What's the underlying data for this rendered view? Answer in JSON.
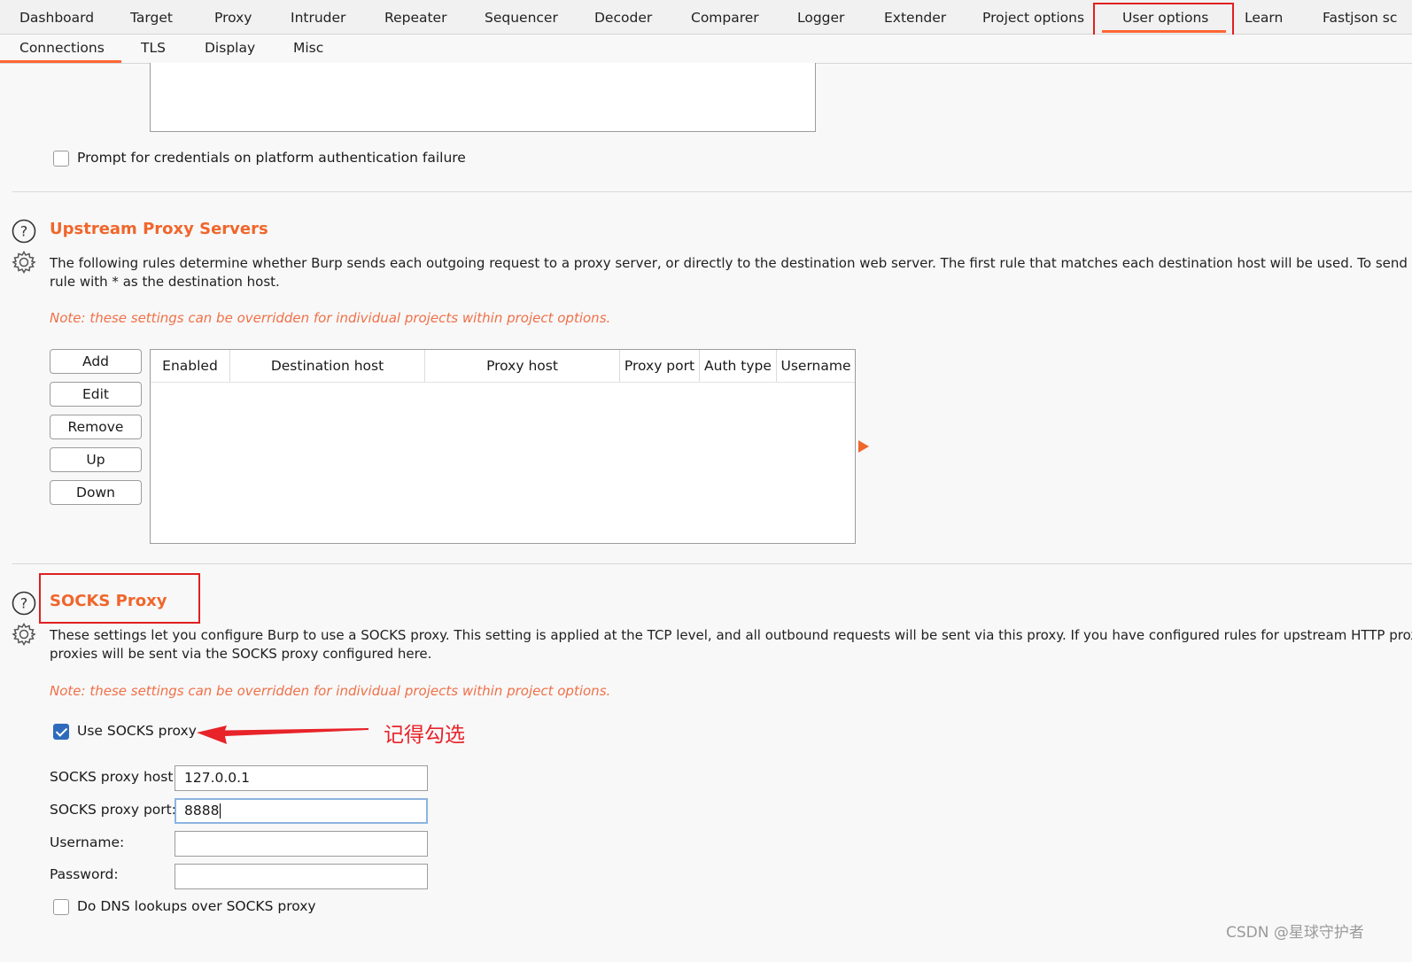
{
  "main_tabs": [
    {
      "label": "Dashboard"
    },
    {
      "label": "Target"
    },
    {
      "label": "Proxy"
    },
    {
      "label": "Intruder"
    },
    {
      "label": "Repeater"
    },
    {
      "label": "Sequencer"
    },
    {
      "label": "Decoder"
    },
    {
      "label": "Comparer"
    },
    {
      "label": "Logger"
    },
    {
      "label": "Extender"
    },
    {
      "label": "Project options"
    },
    {
      "label": "User options"
    },
    {
      "label": "Learn"
    },
    {
      "label": "Fastjson sc"
    }
  ],
  "active_main_tab": "User options",
  "sub_tabs": [
    {
      "label": "Connections"
    },
    {
      "label": "TLS"
    },
    {
      "label": "Display"
    },
    {
      "label": "Misc"
    }
  ],
  "active_sub_tab": "Connections",
  "platform_auth": {
    "prompt_label": "Prompt for credentials on platform authentication failure",
    "prompt_checked": false
  },
  "upstream": {
    "title": "Upstream Proxy Servers",
    "desc_line1": "The following rules determine whether Burp sends each outgoing request to a proxy server, or directly to the destination web server. The first rule that matches each destination host will be used. To send all traffic",
    "desc_line2": "rule with * as the destination host.",
    "note": "Note: these settings can be overridden for individual projects within project options.",
    "buttons": {
      "add": "Add",
      "edit": "Edit",
      "remove": "Remove",
      "up": "Up",
      "down": "Down"
    },
    "columns": [
      "Enabled",
      "Destination host",
      "Proxy host",
      "Proxy port",
      "Auth type",
      "Username"
    ]
  },
  "socks": {
    "title": "SOCKS Proxy",
    "desc_line1": "These settings let you configure Burp to use a SOCKS proxy. This setting is applied at the TCP level, and all outbound requests will be sent via this proxy. If you have configured rules for upstream HTTP proxy servers",
    "desc_line2": "proxies will be sent via the SOCKS proxy configured here.",
    "note": "Note: these settings can be overridden for individual projects within project options.",
    "use_label": "Use SOCKS proxy",
    "use_checked": true,
    "annotation": "记得勾选",
    "host_label": "SOCKS proxy host:",
    "host_value": "127.0.0.1",
    "port_label": "SOCKS proxy port:",
    "port_value": "8888",
    "username_label": "Username:",
    "username_value": "",
    "password_label": "Password:",
    "password_value": "",
    "dns_label": "Do DNS lookups over SOCKS proxy",
    "dns_checked": false
  },
  "watermark": "CSDN @星球守护者",
  "colors": {
    "accent": "#f0662b",
    "highlight": "#e02020",
    "checkbox": "#2f6bbd"
  }
}
